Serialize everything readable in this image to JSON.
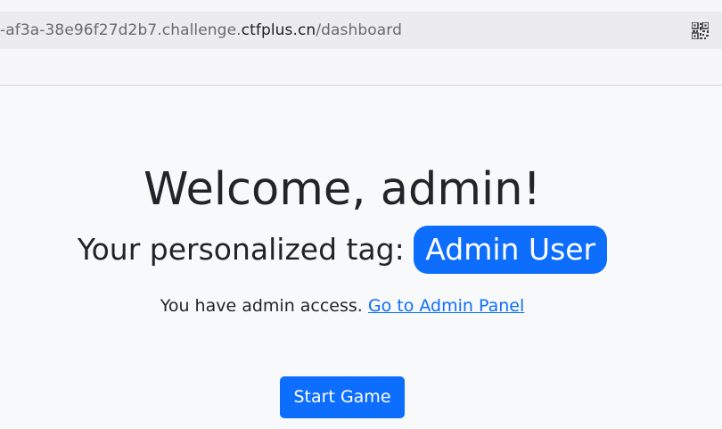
{
  "browser": {
    "url_prefix": "-af3a-38e96f27d2b7.challenge.",
    "url_host": "ctfplus.cn",
    "url_path": "/dashboard",
    "qr_icon": "qr-code-icon"
  },
  "page": {
    "welcome_heading": "Welcome, admin!",
    "tag_label": "Your personalized tag:",
    "tag_value": "Admin User",
    "access_text": "You have admin access.",
    "admin_link_label": "Go to Admin Panel",
    "start_button_label": "Start Game"
  },
  "colors": {
    "page_background": "#f8f9fa",
    "primary": "#0d6efd",
    "text": "#212529"
  }
}
